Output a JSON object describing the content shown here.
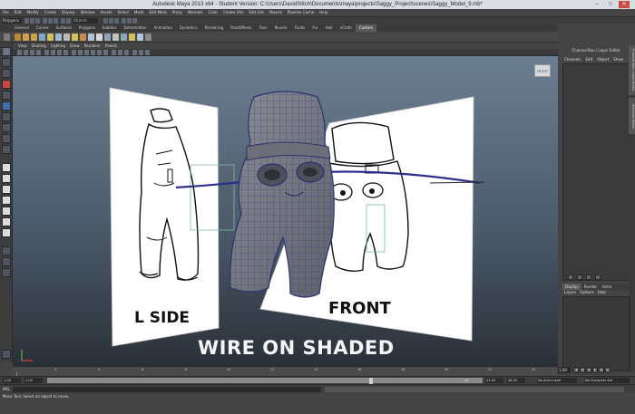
{
  "window": {
    "title": "Autodesk Maya 2013 x64 - Student Version: C:\\Users\\DavidStitch\\Documents\\maya\\projects\\Saggy_Project\\scenes\\Saggy_Model_9.mb*",
    "minimize": "–",
    "maximize": "□",
    "close": "✕"
  },
  "menubar": {
    "items": [
      "File",
      "Edit",
      "Modify",
      "Create",
      "Display",
      "Window",
      "Assets",
      "Select",
      "Mesh",
      "Edit Mesh",
      "Proxy",
      "Normals",
      "Color",
      "Create UVs",
      "Edit UVs",
      "Muscle",
      "Pipeline Cache",
      "Help"
    ]
  },
  "statusline": {
    "mode": "Polygons",
    "object_field": "Objects"
  },
  "shelf": {
    "tabs": [
      "General",
      "Curves",
      "Surfaces",
      "Polygons",
      "Subdivs",
      "Deformation",
      "Animation",
      "Dynamics",
      "Rendering",
      "PaintEffects",
      "Toon",
      "Muscle",
      "Fluids",
      "Fur",
      "Hair",
      "nCloth",
      "Custom"
    ],
    "active_tab": "Custom"
  },
  "panel": {
    "menu": [
      "View",
      "Shading",
      "Lighting",
      "Show",
      "Renderer",
      "Panels"
    ],
    "viewcube_label": "FRONT"
  },
  "scene": {
    "left_plane_label": "L SIDE",
    "front_plane_label": "FRONT",
    "overlay_caption": "Wire on Shaded"
  },
  "channel_box": {
    "title": "Channel Box / Layer Editor",
    "menu": [
      "Channels",
      "Edit",
      "Object",
      "Show"
    ],
    "side_tabs": [
      "Channel Box / Layer Editor",
      "Attribute Editor"
    ]
  },
  "layer_editor": {
    "tabs": [
      "Display",
      "Render",
      "Anim"
    ],
    "active_tab": "Display",
    "menu": [
      "Layers",
      "Options",
      "Help"
    ]
  },
  "time_slider": {
    "ticks": [
      "2",
      "4",
      "6",
      "8",
      "10",
      "12",
      "14",
      "16",
      "18",
      "20",
      "22",
      "24"
    ],
    "current_time": "1.00",
    "playback_buttons": [
      "|◀",
      "◀|",
      "◀",
      "▶",
      "|▶",
      "▶|"
    ]
  },
  "range_slider": {
    "start": "1.00",
    "start_inner": "1.00",
    "handle_value": "24",
    "end_inner": "24.00",
    "end": "48.00",
    "anim_layer": "No Anim Layer",
    "char_set": "No Character Set"
  },
  "command_line": {
    "label": "MEL"
  },
  "help_line": {
    "text": "Move Tool: Select an object to move."
  }
}
